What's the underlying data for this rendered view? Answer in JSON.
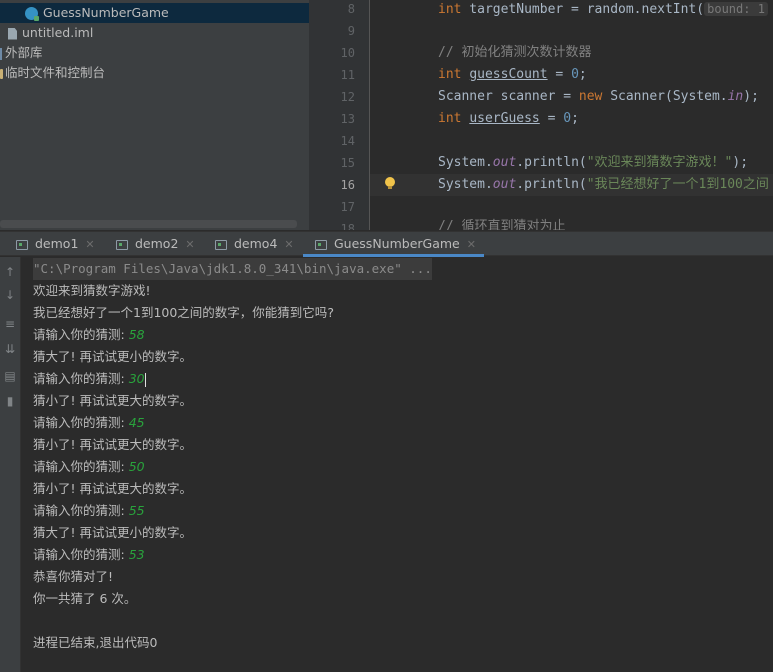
{
  "project_tree": {
    "items": [
      {
        "label": "GuessNumberGame",
        "icon": "java-class-icon",
        "selected": true
      },
      {
        "label": "untitled.iml",
        "icon": "iml-file-icon"
      },
      {
        "label": "外部库",
        "icon": "external-libraries-icon"
      },
      {
        "label": "临时文件和控制台",
        "icon": "scratches-icon"
      }
    ]
  },
  "editor": {
    "line_numbers": [
      "8",
      "9",
      "10",
      "11",
      "12",
      "13",
      "14",
      "15",
      "16",
      "17",
      "18"
    ],
    "current_line": "16",
    "lines": {
      "l8": {
        "kw": "int",
        "mid": " targetNumber = random.nextInt(",
        "hint": "bound: 1"
      },
      "l10": {
        "comment": "// 初始化猜测次数计数器"
      },
      "l11": {
        "kw": "int",
        "var": "guessCount",
        "eq": " = ",
        "num": "0",
        "end": ";"
      },
      "l12": {
        "a": "Scanner scanner = ",
        "kw": "new",
        "b": " Scanner(System.",
        "fld": "in",
        "c": ");"
      },
      "l13": {
        "kw": "int",
        "var": "userGuess",
        "eq": " = ",
        "num": "0",
        "end": ";"
      },
      "l15": {
        "a": "System.",
        "fld": "out",
        "b": ".println(",
        "str": "\"欢迎来到猜数字游戏！\"",
        "c": ");"
      },
      "l16": {
        "a": "System.",
        "fld": "out",
        "b": ".println(",
        "str": "\"我已经想好了一个1到100之间"
      },
      "l18": {
        "comment": "// 循环直到猜对为止"
      }
    }
  },
  "run_panel": {
    "tabs": [
      {
        "label": "demo1",
        "active": false
      },
      {
        "label": "demo2",
        "active": false
      },
      {
        "label": "demo4",
        "active": false
      },
      {
        "label": "GuessNumberGame",
        "active": true
      }
    ],
    "toolbar_icons": [
      "up-arrow-icon",
      "down-arrow-icon",
      "soft-wrap-icon",
      "scroll-to-end-icon",
      "print-icon",
      "trash-icon"
    ],
    "command_line": "\"C:\\Program Files\\Java\\jdk1.8.0_341\\bin\\java.exe\" ...",
    "output": [
      {
        "text": "欢迎来到猜数字游戏!"
      },
      {
        "text": "我已经想好了一个1到100之间的数字，你能猜到它吗?"
      },
      {
        "text": "请输入你的猜测: ",
        "input": "58"
      },
      {
        "text": "猜大了! 再试试更小的数字。"
      },
      {
        "text": "请输入你的猜测: ",
        "input": "30"
      },
      {
        "text": "猜小了! 再试试更大的数字。"
      },
      {
        "text": "请输入你的猜测: ",
        "input": "45"
      },
      {
        "text": "猜小了! 再试试更大的数字。"
      },
      {
        "text": "请输入你的猜测: ",
        "input": "50"
      },
      {
        "text": "猜小了! 再试试更大的数字。"
      },
      {
        "text": "请输入你的猜测: ",
        "input": "55"
      },
      {
        "text": "猜大了! 再试试更小的数字。"
      },
      {
        "text": "请输入你的猜测: ",
        "input": "53"
      },
      {
        "text": "恭喜你猜对了!"
      },
      {
        "text": "你一共猜了 6 次。"
      },
      {
        "text": ""
      },
      {
        "text": "进程已结束,退出代码0"
      }
    ]
  },
  "colors": {
    "background": "#2b2b2b",
    "panel": "#3c3f41",
    "selected_row": "#0d293e",
    "user_input": "#29a33c",
    "active_tab_underline": "#4a88c7",
    "keyword": "#cc7832",
    "string": "#6a8759",
    "number": "#6897bb"
  }
}
